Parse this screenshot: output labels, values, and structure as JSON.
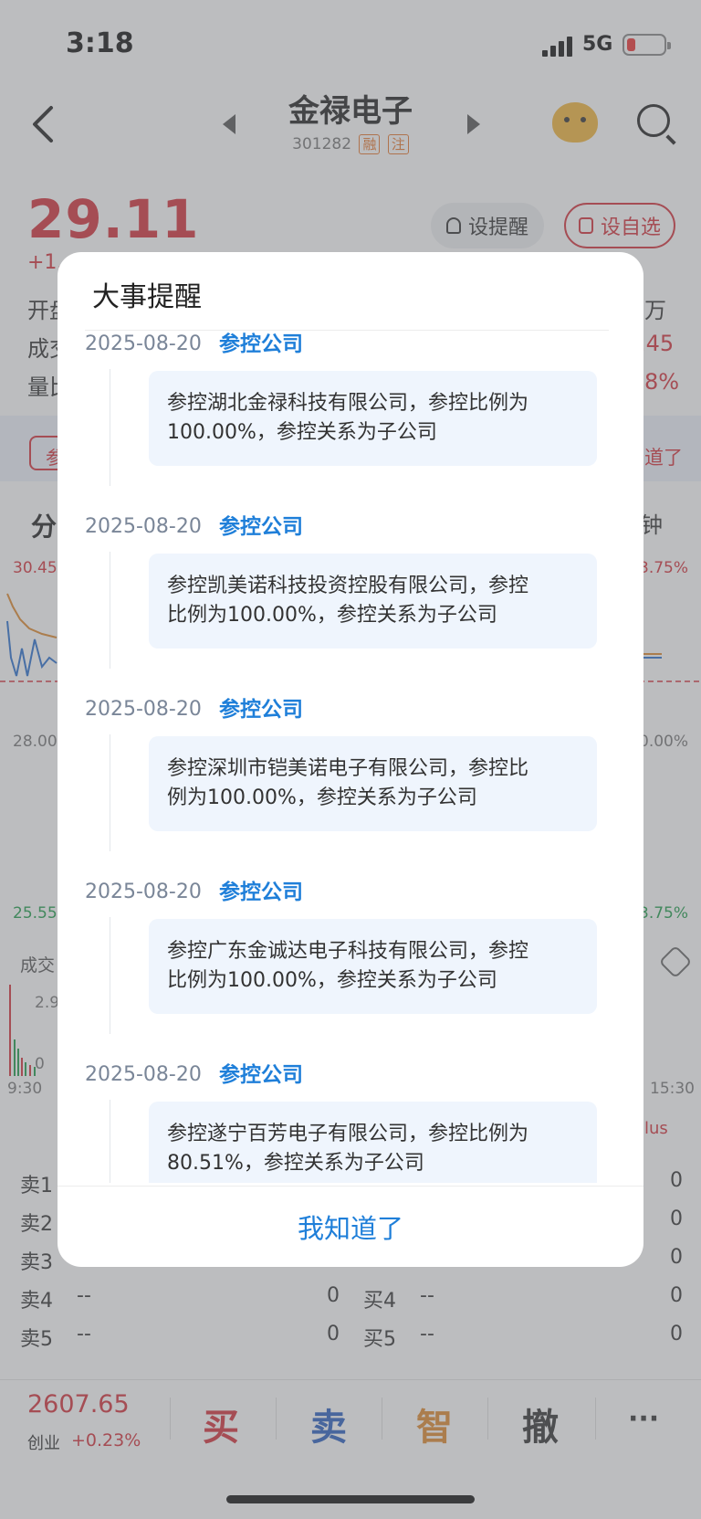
{
  "status_bar": {
    "time": "3:18",
    "network": "5G"
  },
  "header": {
    "stock_name": "金禄电子",
    "stock_code": "301282",
    "tag_margin": "融",
    "tag_note": "注"
  },
  "quote": {
    "price": "29.11",
    "change": "+1.",
    "alert_button": "设提醒",
    "watchlist_button": "设自选",
    "row_labels": [
      "开盘",
      "成交",
      "量比"
    ],
    "right_values": [
      "万",
      ".45",
      "8%"
    ]
  },
  "info_strip": {
    "left": "参",
    "right": "道了"
  },
  "chart": {
    "tab": "分",
    "period": "钟",
    "y_high": "30.45",
    "y_mid": "28.00",
    "y_low": "25.55",
    "pct_high": "3.75%",
    "pct_mid": "0.00%",
    "pct_low": "3.75%",
    "volume_label": "成交",
    "vol_high": "2.9",
    "vol_low": "0",
    "time_start": "9:30",
    "time_end": "15:30",
    "plus_label": "lus"
  },
  "orderbook": {
    "sell_labels": [
      "卖1",
      "卖2",
      "卖3",
      "卖4",
      "卖5"
    ],
    "buy_labels": [
      "买4",
      "买5"
    ],
    "placeholder": "--",
    "zero": "0"
  },
  "bottom_bar": {
    "index_value": "2607.65",
    "index_name": "创业",
    "index_change": "+0.23%",
    "buy": "买",
    "sell": "卖",
    "smart": "智",
    "cancel": "撤",
    "more": "···"
  },
  "dialog": {
    "title": "大事提醒",
    "events": [
      {
        "date": "2025-08-20",
        "type": "参控公司",
        "text_l1": "参控湖北金禄科技有限公司，参控比例为",
        "text_l2": "100.00%，参控关系为子公司"
      },
      {
        "date": "2025-08-20",
        "type": "参控公司",
        "text_l1": "参控凯美诺科技投资控股有限公司，参控",
        "text_l2": "比例为100.00%，参控关系为子公司"
      },
      {
        "date": "2025-08-20",
        "type": "参控公司",
        "text_l1": "参控深圳市铠美诺电子有限公司，参控比",
        "text_l2": "例为100.00%，参控关系为子公司"
      },
      {
        "date": "2025-08-20",
        "type": "参控公司",
        "text_l1": "参控广东金诚达电子科技有限公司，参控",
        "text_l2": "比例为100.00%，参控关系为子公司"
      },
      {
        "date": "2025-08-20",
        "type": "参控公司",
        "text_l1": "参控遂宁百芳电子有限公司，参控比例为",
        "text_l2": "80.51%，参控关系为子公司"
      }
    ],
    "dismiss": "我知道了"
  }
}
